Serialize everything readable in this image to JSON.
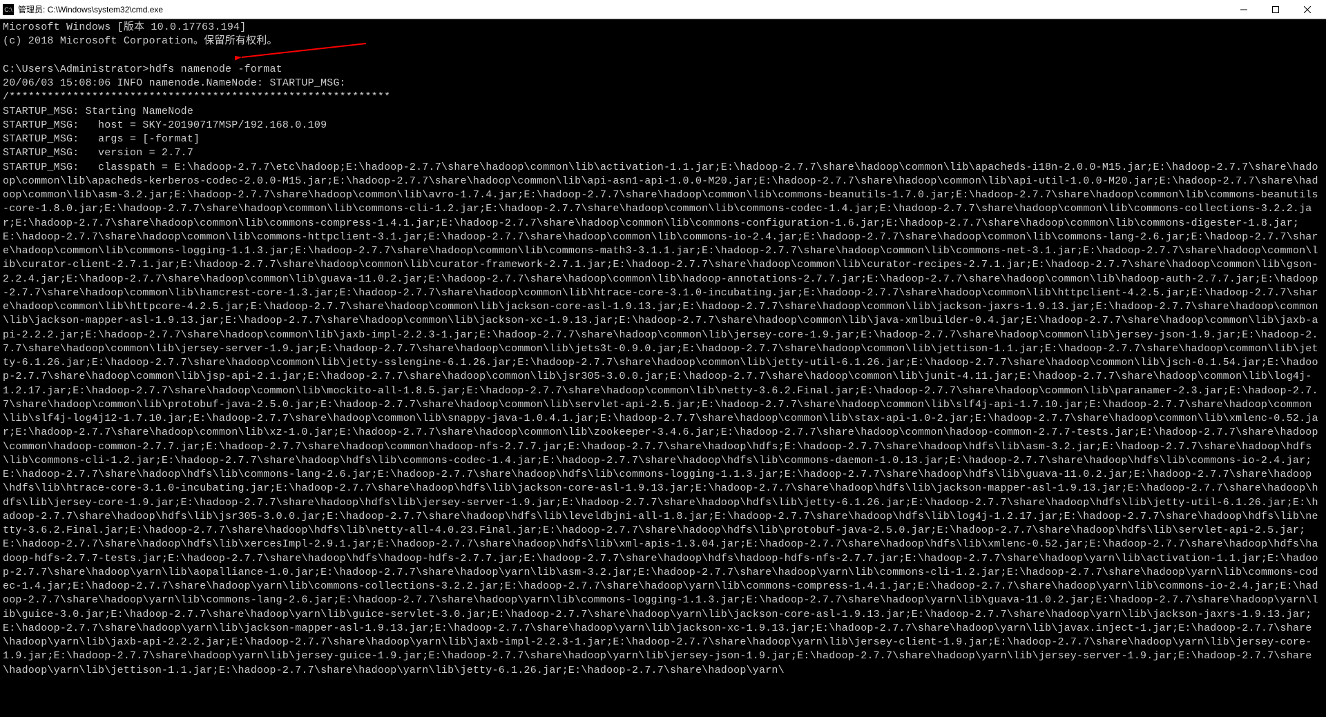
{
  "titlebar": {
    "icon_text": "C:\\",
    "title": "管理员: C:\\Windows\\system32\\cmd.exe"
  },
  "header": {
    "line1": "Microsoft Windows [版本 10.0.17763.194]",
    "line2": "(c) 2018 Microsoft Corporation。保留所有权利。"
  },
  "prompt": {
    "path": "C:\\Users\\Administrator>",
    "command": "hdfs namenode -format"
  },
  "log": {
    "timestamp": "20/06/03 15:08:06 INFO namenode.NameNode: STARTUP_MSG:",
    "divider": "/************************************************************",
    "msg_start": "STARTUP_MSG: Starting NameNode",
    "msg_host": "STARTUP_MSG:   host = SKY-20190717MSP/192.168.0.109",
    "msg_args": "STARTUP_MSG:   args = [-format]",
    "msg_version": "STARTUP_MSG:   version = 2.7.7",
    "msg_classpath_label": "STARTUP_MSG:   classpath = ",
    "classpath": "E:\\hadoop-2.7.7\\etc\\hadoop;E:\\hadoop-2.7.7\\share\\hadoop\\common\\lib\\activation-1.1.jar;E:\\hadoop-2.7.7\\share\\hadoop\\common\\lib\\apacheds-i18n-2.0.0-M15.jar;E:\\hadoop-2.7.7\\share\\hadoop\\common\\lib\\apacheds-kerberos-codec-2.0.0-M15.jar;E:\\hadoop-2.7.7\\share\\hadoop\\common\\lib\\api-asn1-api-1.0.0-M20.jar;E:\\hadoop-2.7.7\\share\\hadoop\\common\\lib\\api-util-1.0.0-M20.jar;E:\\hadoop-2.7.7\\share\\hadoop\\common\\lib\\asm-3.2.jar;E:\\hadoop-2.7.7\\share\\hadoop\\common\\lib\\avro-1.7.4.jar;E:\\hadoop-2.7.7\\share\\hadoop\\common\\lib\\commons-beanutils-1.7.0.jar;E:\\hadoop-2.7.7\\share\\hadoop\\common\\lib\\commons-beanutils-core-1.8.0.jar;E:\\hadoop-2.7.7\\share\\hadoop\\common\\lib\\commons-cli-1.2.jar;E:\\hadoop-2.7.7\\share\\hadoop\\common\\lib\\commons-codec-1.4.jar;E:\\hadoop-2.7.7\\share\\hadoop\\common\\lib\\commons-collections-3.2.2.jar;E:\\hadoop-2.7.7\\share\\hadoop\\common\\lib\\commons-compress-1.4.1.jar;E:\\hadoop-2.7.7\\share\\hadoop\\common\\lib\\commons-configuration-1.6.jar;E:\\hadoop-2.7.7\\share\\hadoop\\common\\lib\\commons-digester-1.8.jar;E:\\hadoop-2.7.7\\share\\hadoop\\common\\lib\\commons-httpclient-3.1.jar;E:\\hadoop-2.7.7\\share\\hadoop\\common\\lib\\commons-io-2.4.jar;E:\\hadoop-2.7.7\\share\\hadoop\\common\\lib\\commons-lang-2.6.jar;E:\\hadoop-2.7.7\\share\\hadoop\\common\\lib\\commons-logging-1.1.3.jar;E:\\hadoop-2.7.7\\share\\hadoop\\common\\lib\\commons-math3-3.1.1.jar;E:\\hadoop-2.7.7\\share\\hadoop\\common\\lib\\commons-net-3.1.jar;E:\\hadoop-2.7.7\\share\\hadoop\\common\\lib\\curator-client-2.7.1.jar;E:\\hadoop-2.7.7\\share\\hadoop\\common\\lib\\curator-framework-2.7.1.jar;E:\\hadoop-2.7.7\\share\\hadoop\\common\\lib\\curator-recipes-2.7.1.jar;E:\\hadoop-2.7.7\\share\\hadoop\\common\\lib\\gson-2.2.4.jar;E:\\hadoop-2.7.7\\share\\hadoop\\common\\lib\\guava-11.0.2.jar;E:\\hadoop-2.7.7\\share\\hadoop\\common\\lib\\hadoop-annotations-2.7.7.jar;E:\\hadoop-2.7.7\\share\\hadoop\\common\\lib\\hadoop-auth-2.7.7.jar;E:\\hadoop-2.7.7\\share\\hadoop\\common\\lib\\hamcrest-core-1.3.jar;E:\\hadoop-2.7.7\\share\\hadoop\\common\\lib\\htrace-core-3.1.0-incubating.jar;E:\\hadoop-2.7.7\\share\\hadoop\\common\\lib\\httpclient-4.2.5.jar;E:\\hadoop-2.7.7\\share\\hadoop\\common\\lib\\httpcore-4.2.5.jar;E:\\hadoop-2.7.7\\share\\hadoop\\common\\lib\\jackson-core-asl-1.9.13.jar;E:\\hadoop-2.7.7\\share\\hadoop\\common\\lib\\jackson-jaxrs-1.9.13.jar;E:\\hadoop-2.7.7\\share\\hadoop\\common\\lib\\jackson-mapper-asl-1.9.13.jar;E:\\hadoop-2.7.7\\share\\hadoop\\common\\lib\\jackson-xc-1.9.13.jar;E:\\hadoop-2.7.7\\share\\hadoop\\common\\lib\\java-xmlbuilder-0.4.jar;E:\\hadoop-2.7.7\\share\\hadoop\\common\\lib\\jaxb-api-2.2.2.jar;E:\\hadoop-2.7.7\\share\\hadoop\\common\\lib\\jaxb-impl-2.2.3-1.jar;E:\\hadoop-2.7.7\\share\\hadoop\\common\\lib\\jersey-core-1.9.jar;E:\\hadoop-2.7.7\\share\\hadoop\\common\\lib\\jersey-json-1.9.jar;E:\\hadoop-2.7.7\\share\\hadoop\\common\\lib\\jersey-server-1.9.jar;E:\\hadoop-2.7.7\\share\\hadoop\\common\\lib\\jets3t-0.9.0.jar;E:\\hadoop-2.7.7\\share\\hadoop\\common\\lib\\jettison-1.1.jar;E:\\hadoop-2.7.7\\share\\hadoop\\common\\lib\\jetty-6.1.26.jar;E:\\hadoop-2.7.7\\share\\hadoop\\common\\lib\\jetty-sslengine-6.1.26.jar;E:\\hadoop-2.7.7\\share\\hadoop\\common\\lib\\jetty-util-6.1.26.jar;E:\\hadoop-2.7.7\\share\\hadoop\\common\\lib\\jsch-0.1.54.jar;E:\\hadoop-2.7.7\\share\\hadoop\\common\\lib\\jsp-api-2.1.jar;E:\\hadoop-2.7.7\\share\\hadoop\\common\\lib\\jsr305-3.0.0.jar;E:\\hadoop-2.7.7\\share\\hadoop\\common\\lib\\junit-4.11.jar;E:\\hadoop-2.7.7\\share\\hadoop\\common\\lib\\log4j-1.2.17.jar;E:\\hadoop-2.7.7\\share\\hadoop\\common\\lib\\mockito-all-1.8.5.jar;E:\\hadoop-2.7.7\\share\\hadoop\\common\\lib\\netty-3.6.2.Final.jar;E:\\hadoop-2.7.7\\share\\hadoop\\common\\lib\\paranamer-2.3.jar;E:\\hadoop-2.7.7\\share\\hadoop\\common\\lib\\protobuf-java-2.5.0.jar;E:\\hadoop-2.7.7\\share\\hadoop\\common\\lib\\servlet-api-2.5.jar;E:\\hadoop-2.7.7\\share\\hadoop\\common\\lib\\slf4j-api-1.7.10.jar;E:\\hadoop-2.7.7\\share\\hadoop\\common\\lib\\slf4j-log4j12-1.7.10.jar;E:\\hadoop-2.7.7\\share\\hadoop\\common\\lib\\snappy-java-1.0.4.1.jar;E:\\hadoop-2.7.7\\share\\hadoop\\common\\lib\\stax-api-1.0-2.jar;E:\\hadoop-2.7.7\\share\\hadoop\\common\\lib\\xmlenc-0.52.jar;E:\\hadoop-2.7.7\\share\\hadoop\\common\\lib\\xz-1.0.jar;E:\\hadoop-2.7.7\\share\\hadoop\\common\\lib\\zookeeper-3.4.6.jar;E:\\hadoop-2.7.7\\share\\hadoop\\common\\hadoop-common-2.7.7-tests.jar;E:\\hadoop-2.7.7\\share\\hadoop\\common\\hadoop-common-2.7.7.jar;E:\\hadoop-2.7.7\\share\\hadoop\\common\\hadoop-nfs-2.7.7.jar;E:\\hadoop-2.7.7\\share\\hadoop\\hdfs;E:\\hadoop-2.7.7\\share\\hadoop\\hdfs\\lib\\asm-3.2.jar;E:\\hadoop-2.7.7\\share\\hadoop\\hdfs\\lib\\commons-cli-1.2.jar;E:\\hadoop-2.7.7\\share\\hadoop\\hdfs\\lib\\commons-codec-1.4.jar;E:\\hadoop-2.7.7\\share\\hadoop\\hdfs\\lib\\commons-daemon-1.0.13.jar;E:\\hadoop-2.7.7\\share\\hadoop\\hdfs\\lib\\commons-io-2.4.jar;E:\\hadoop-2.7.7\\share\\hadoop\\hdfs\\lib\\commons-lang-2.6.jar;E:\\hadoop-2.7.7\\share\\hadoop\\hdfs\\lib\\commons-logging-1.1.3.jar;E:\\hadoop-2.7.7\\share\\hadoop\\hdfs\\lib\\guava-11.0.2.jar;E:\\hadoop-2.7.7\\share\\hadoop\\hdfs\\lib\\htrace-core-3.1.0-incubating.jar;E:\\hadoop-2.7.7\\share\\hadoop\\hdfs\\lib\\jackson-core-asl-1.9.13.jar;E:\\hadoop-2.7.7\\share\\hadoop\\hdfs\\lib\\jackson-mapper-asl-1.9.13.jar;E:\\hadoop-2.7.7\\share\\hadoop\\hdfs\\lib\\jersey-core-1.9.jar;E:\\hadoop-2.7.7\\share\\hadoop\\hdfs\\lib\\jersey-server-1.9.jar;E:\\hadoop-2.7.7\\share\\hadoop\\hdfs\\lib\\jetty-6.1.26.jar;E:\\hadoop-2.7.7\\share\\hadoop\\hdfs\\lib\\jetty-util-6.1.26.jar;E:\\hadoop-2.7.7\\share\\hadoop\\hdfs\\lib\\jsr305-3.0.0.jar;E:\\hadoop-2.7.7\\share\\hadoop\\hdfs\\lib\\leveldbjni-all-1.8.jar;E:\\hadoop-2.7.7\\share\\hadoop\\hdfs\\lib\\log4j-1.2.17.jar;E:\\hadoop-2.7.7\\share\\hadoop\\hdfs\\lib\\netty-3.6.2.Final.jar;E:\\hadoop-2.7.7\\share\\hadoop\\hdfs\\lib\\netty-all-4.0.23.Final.jar;E:\\hadoop-2.7.7\\share\\hadoop\\hdfs\\lib\\protobuf-java-2.5.0.jar;E:\\hadoop-2.7.7\\share\\hadoop\\hdfs\\lib\\servlet-api-2.5.jar;E:\\hadoop-2.7.7\\share\\hadoop\\hdfs\\lib\\xercesImpl-2.9.1.jar;E:\\hadoop-2.7.7\\share\\hadoop\\hdfs\\lib\\xml-apis-1.3.04.jar;E:\\hadoop-2.7.7\\share\\hadoop\\hdfs\\lib\\xmlenc-0.52.jar;E:\\hadoop-2.7.7\\share\\hadoop\\hdfs\\hadoop-hdfs-2.7.7-tests.jar;E:\\hadoop-2.7.7\\share\\hadoop\\hdfs\\hadoop-hdfs-2.7.7.jar;E:\\hadoop-2.7.7\\share\\hadoop\\hdfs\\hadoop-hdfs-nfs-2.7.7.jar;E:\\hadoop-2.7.7\\share\\hadoop\\yarn\\lib\\activation-1.1.jar;E:\\hadoop-2.7.7\\share\\hadoop\\yarn\\lib\\aopalliance-1.0.jar;E:\\hadoop-2.7.7\\share\\hadoop\\yarn\\lib\\asm-3.2.jar;E:\\hadoop-2.7.7\\share\\hadoop\\yarn\\lib\\commons-cli-1.2.jar;E:\\hadoop-2.7.7\\share\\hadoop\\yarn\\lib\\commons-codec-1.4.jar;E:\\hadoop-2.7.7\\share\\hadoop\\yarn\\lib\\commons-collections-3.2.2.jar;E:\\hadoop-2.7.7\\share\\hadoop\\yarn\\lib\\commons-compress-1.4.1.jar;E:\\hadoop-2.7.7\\share\\hadoop\\yarn\\lib\\commons-io-2.4.jar;E:\\hadoop-2.7.7\\share\\hadoop\\yarn\\lib\\commons-lang-2.6.jar;E:\\hadoop-2.7.7\\share\\hadoop\\yarn\\lib\\commons-logging-1.1.3.jar;E:\\hadoop-2.7.7\\share\\hadoop\\yarn\\lib\\guava-11.0.2.jar;E:\\hadoop-2.7.7\\share\\hadoop\\yarn\\lib\\guice-3.0.jar;E:\\hadoop-2.7.7\\share\\hadoop\\yarn\\lib\\guice-servlet-3.0.jar;E:\\hadoop-2.7.7\\share\\hadoop\\yarn\\lib\\jackson-core-asl-1.9.13.jar;E:\\hadoop-2.7.7\\share\\hadoop\\yarn\\lib\\jackson-jaxrs-1.9.13.jar;E:\\hadoop-2.7.7\\share\\hadoop\\yarn\\lib\\jackson-mapper-asl-1.9.13.jar;E:\\hadoop-2.7.7\\share\\hadoop\\yarn\\lib\\jackson-xc-1.9.13.jar;E:\\hadoop-2.7.7\\share\\hadoop\\yarn\\lib\\javax.inject-1.jar;E:\\hadoop-2.7.7\\share\\hadoop\\yarn\\lib\\jaxb-api-2.2.2.jar;E:\\hadoop-2.7.7\\share\\hadoop\\yarn\\lib\\jaxb-impl-2.2.3-1.jar;E:\\hadoop-2.7.7\\share\\hadoop\\yarn\\lib\\jersey-client-1.9.jar;E:\\hadoop-2.7.7\\share\\hadoop\\yarn\\lib\\jersey-core-1.9.jar;E:\\hadoop-2.7.7\\share\\hadoop\\yarn\\lib\\jersey-guice-1.9.jar;E:\\hadoop-2.7.7\\share\\hadoop\\yarn\\lib\\jersey-json-1.9.jar;E:\\hadoop-2.7.7\\share\\hadoop\\yarn\\lib\\jersey-server-1.9.jar;E:\\hadoop-2.7.7\\share\\hadoop\\yarn\\lib\\jettison-1.1.jar;E:\\hadoop-2.7.7\\share\\hadoop\\yarn\\lib\\jetty-6.1.26.jar;E:\\hadoop-2.7.7\\share\\hadoop\\yarn\\"
  }
}
